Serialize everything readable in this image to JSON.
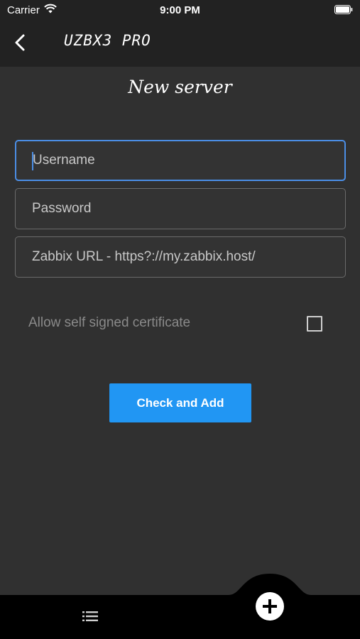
{
  "status_bar": {
    "carrier": "Carrier",
    "time": "9:00 PM"
  },
  "app_bar": {
    "title": "UZBX3 PRO"
  },
  "form": {
    "title": "New server",
    "username": {
      "placeholder": "Username",
      "value": ""
    },
    "password": {
      "placeholder": "Password",
      "value": ""
    },
    "url": {
      "placeholder": "Zabbix URL - https?://my.zabbix.host/",
      "value": ""
    },
    "self_signed_label": "Allow self signed certificate",
    "self_signed_checked": false,
    "submit_label": "Check and Add"
  },
  "colors": {
    "accent": "#2196f3",
    "focus_border": "#4b8ee6",
    "background": "#303030",
    "app_bar": "#222222",
    "bottom_bar": "#000000"
  },
  "icons": {
    "back": "chevron-left-icon",
    "list": "list-icon",
    "add": "plus-circle-icon"
  }
}
